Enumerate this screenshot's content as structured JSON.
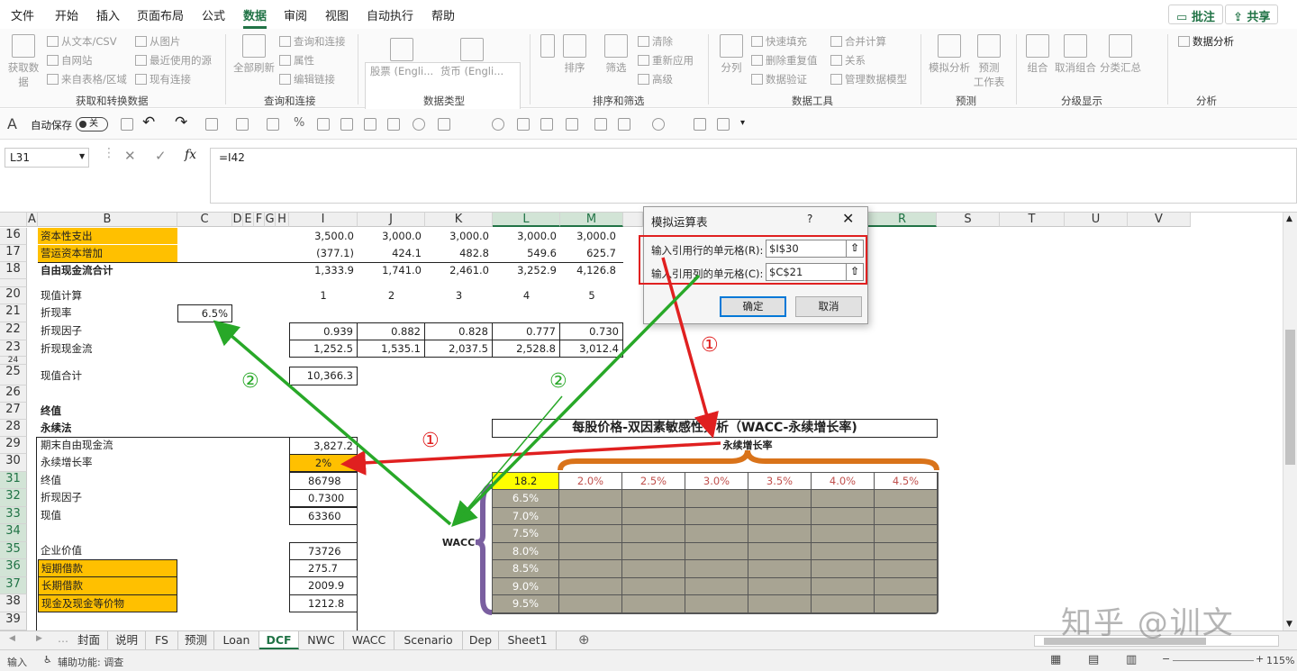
{
  "menu": {
    "tabs": [
      "文件",
      "开始",
      "插入",
      "页面布局",
      "公式",
      "数据",
      "审阅",
      "视图",
      "自动执行",
      "帮助"
    ],
    "active": "数据",
    "comments_btn": "批注",
    "share_btn": "共享"
  },
  "ribbon": {
    "get_data": {
      "big": "获取数\n据",
      "items": [
        "从文本/CSV",
        "自网站",
        "来自表格/区域",
        "从图片",
        "最近使用的源",
        "现有连接"
      ],
      "label": "获取和转换数据"
    },
    "queries": {
      "big": "全部刷新",
      "items": [
        "查询和连接",
        "属性",
        "编辑链接"
      ],
      "label": "查询和连接"
    },
    "data_types": {
      "items": [
        "股票 (Engli...",
        "货币 (Engli..."
      ],
      "label": "数据类型"
    },
    "sort_filter": {
      "items": [
        "排序",
        "筛选",
        "清除",
        "重新应用",
        "高级"
      ],
      "label": "排序和筛选"
    },
    "tools": {
      "big": "分列",
      "items": [
        "快速填充",
        "删除重复值",
        "数据验证",
        "合并计算",
        "关系",
        "管理数据模型"
      ],
      "label": "数据工具"
    },
    "forecast": {
      "items": [
        "模拟分析",
        "预测\n工作表"
      ],
      "label": "预测"
    },
    "outline": {
      "items": [
        "组合",
        "取消组合",
        "分类汇总"
      ],
      "label": "分级显示"
    },
    "analysis": {
      "items": [
        "数据分析"
      ],
      "label": "分析"
    }
  },
  "qat": {
    "autosave_label": "自动保存",
    "autosave_state": "关"
  },
  "formula_bar": {
    "name_box": "L31",
    "formula": "=I42"
  },
  "columns": [
    "A",
    "B",
    "C",
    "D",
    "E",
    "F",
    "G",
    "H",
    "I",
    "J",
    "K",
    "L",
    "M",
    "R",
    "S",
    "T",
    "U",
    "V"
  ],
  "rows": [
    "16",
    "17",
    "18",
    "20",
    "21",
    "22",
    "23",
    "24",
    "25",
    "26",
    "27",
    "28",
    "29",
    "30",
    "31",
    "32",
    "33",
    "34",
    "35",
    "36",
    "37",
    "38",
    "39"
  ],
  "cells": {
    "r16": {
      "b": "资本性支出",
      "vals": [
        "3,500.0",
        "3,000.0",
        "3,000.0",
        "3,000.0",
        "3,000.0"
      ]
    },
    "r17": {
      "b": "营运资本增加",
      "vals": [
        "(377.1)",
        "424.1",
        "482.8",
        "549.6",
        "625.7"
      ]
    },
    "r18": {
      "b": "自由现金流合计",
      "vals": [
        "1,333.9",
        "1,741.0",
        "2,461.0",
        "3,252.9",
        "4,126.8"
      ]
    },
    "r20": {
      "b": "现值计算",
      "vals": [
        "1",
        "2",
        "3",
        "4",
        "5"
      ]
    },
    "r21": {
      "b": "折现率",
      "c": "6.5%"
    },
    "r22": {
      "b": "折现因子",
      "vals": [
        "0.939",
        "0.882",
        "0.828",
        "0.777",
        "0.730"
      ]
    },
    "r23": {
      "b": "折现现金流",
      "vals": [
        "1,252.5",
        "1,535.1",
        "2,037.5",
        "2,528.8",
        "3,012.4"
      ]
    },
    "r25": {
      "b": "现值合计",
      "i": "10,366.3"
    },
    "r27": {
      "b": "终值"
    },
    "r28": {
      "b": "永续法"
    },
    "r29": {
      "b": "期末自由现金流",
      "i": "3,827.2"
    },
    "r30": {
      "b": "永续增长率",
      "i": "2%"
    },
    "r31": {
      "b": "终值",
      "i": "86798"
    },
    "r32": {
      "b": "折现因子",
      "i": "0.7300"
    },
    "r33": {
      "b": "现值",
      "i": "63360"
    },
    "r35": {
      "b": "企业价值",
      "i": "73726"
    },
    "r36": {
      "b": "短期借款",
      "i": "275.7"
    },
    "r37": {
      "b": "长期借款",
      "i": "2009.9"
    },
    "r38": {
      "b": "现金及现金等价物",
      "i": "1212.8"
    }
  },
  "sensitivity": {
    "title": "每股价格-双因素敏感性分析（WACC-永续增长率)",
    "growth_label": "永续增长率",
    "wacc_label": "WACC",
    "corner": "18.2",
    "growth_rates": [
      "2.0%",
      "2.5%",
      "3.0%",
      "3.5%",
      "4.0%",
      "4.5%"
    ],
    "wacc_rates": [
      "6.5%",
      "7.0%",
      "7.5%",
      "8.0%",
      "8.5%",
      "9.0%",
      "9.5%"
    ]
  },
  "dialog": {
    "title": "模拟运算表",
    "help": "?",
    "row_label": "输入引用行的单元格(R):",
    "row_value": "$I$30",
    "col_label": "输入引用列的单元格(C):",
    "col_value": "$C$21",
    "ok": "确定",
    "cancel": "取消"
  },
  "annotations": {
    "mark1": "①",
    "mark2": "②"
  },
  "sheet_tabs": [
    "封面",
    "说明",
    "FS",
    "预测",
    "Loan",
    "DCF",
    "NWC",
    "WACC",
    "Scenario",
    "Dep",
    "Sheet1"
  ],
  "active_sheet": "DCF",
  "status": {
    "mode": "输入",
    "accessibility": "辅助功能: 调查",
    "zoom": "115%"
  },
  "watermark": "知乎 @训文",
  "colors": {
    "accent": "#217346",
    "orange": "#ffc000",
    "red_arrow": "#e02020",
    "green_arrow": "#28a828",
    "table_gray": "#a8a493",
    "purple_brace": "#7a5fa0",
    "orange_brace": "#d9731a"
  }
}
